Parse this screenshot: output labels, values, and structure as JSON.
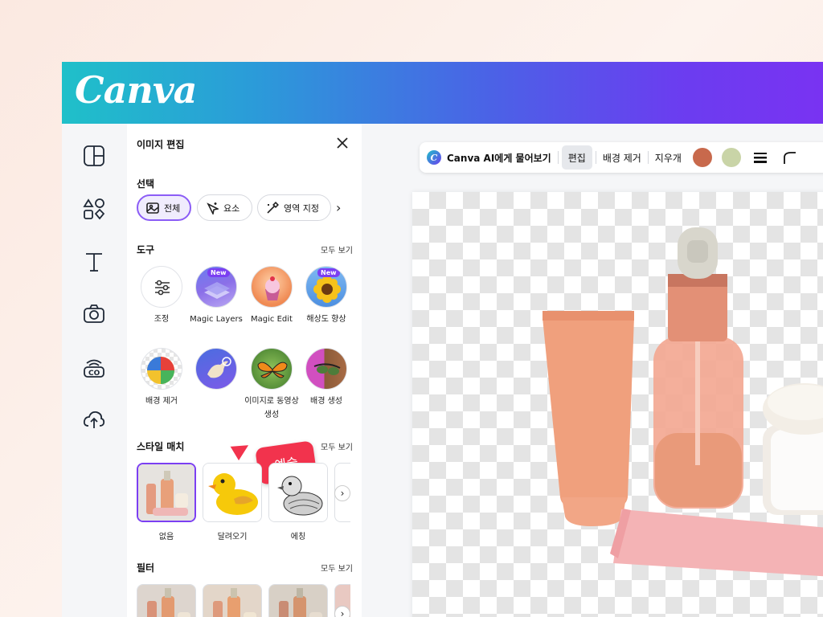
{
  "header": {
    "logo": "Canva"
  },
  "rail": {
    "items": [
      "layout-icon",
      "elements-icon",
      "text-icon",
      "camera-icon",
      "brand-icon",
      "upload-icon"
    ]
  },
  "panel": {
    "title": "이미지 편집",
    "selection": {
      "label": "선택",
      "chips": [
        {
          "label": "전체",
          "icon": "image-icon",
          "active": true
        },
        {
          "label": "요소",
          "icon": "sparkle-cursor-icon",
          "active": false
        },
        {
          "label": "영역 지정",
          "icon": "magic-brush-icon",
          "active": false
        }
      ]
    },
    "tools": {
      "label": "도구",
      "see_all": "모두 보기",
      "items": [
        {
          "label": "조정",
          "new": false
        },
        {
          "label": "Magic Layers",
          "new": true
        },
        {
          "label": "Magic Edit",
          "new": false
        },
        {
          "label": "해상도 향상",
          "new": true
        },
        {
          "label": "배경 제거",
          "new": false
        },
        {
          "label": "",
          "new": false
        },
        {
          "label": "이미지로 동영상 생성",
          "new": false
        },
        {
          "label": "배경 생성",
          "new": false
        }
      ],
      "new_badge": "New"
    },
    "style_match": {
      "label": "스타일 매치",
      "see_all": "모두 보기",
      "items": [
        "없음",
        "달려오기",
        "에칭"
      ]
    },
    "filter": {
      "label": "필터",
      "see_all": "모두 보기"
    },
    "tooltip": "예슬"
  },
  "toolbar": {
    "ai_label": "Canva AI에게 물어보기",
    "edit": "편집",
    "remove_bg": "배경 제거",
    "eraser": "지우개",
    "swatches": [
      "#c8694c",
      "#c9d4a7"
    ]
  }
}
